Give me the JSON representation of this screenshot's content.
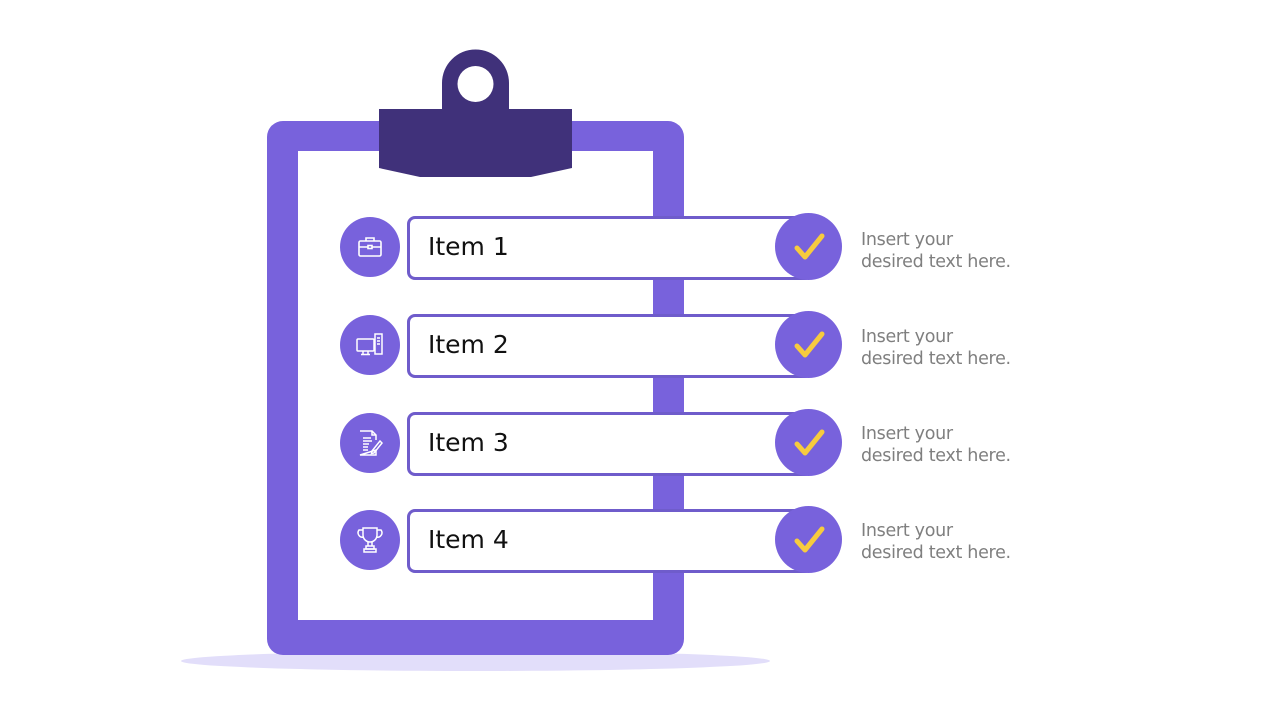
{
  "slide": {
    "colors": {
      "board": "#7862dc",
      "clip": "#40317a",
      "check": "#f7cb3e",
      "shadow": "#e2defa",
      "description_text": "#7f7f7f"
    },
    "items": [
      {
        "label": "Item 1",
        "icon": "briefcase-icon",
        "status_icon": "checkmark-icon",
        "description_line1": "Insert your",
        "description_line2": "desired text here."
      },
      {
        "label": "Item 2",
        "icon": "desktop-computer-icon",
        "status_icon": "checkmark-icon",
        "description_line1": "Insert your",
        "description_line2": "desired text here."
      },
      {
        "label": "Item 3",
        "icon": "document-edit-icon",
        "status_icon": "checkmark-icon",
        "description_line1": "Insert your",
        "description_line2": "desired text here."
      },
      {
        "label": "Item 4",
        "icon": "trophy-icon",
        "status_icon": "checkmark-icon",
        "description_line1": "Insert your",
        "description_line2": "desired text here."
      }
    ]
  }
}
